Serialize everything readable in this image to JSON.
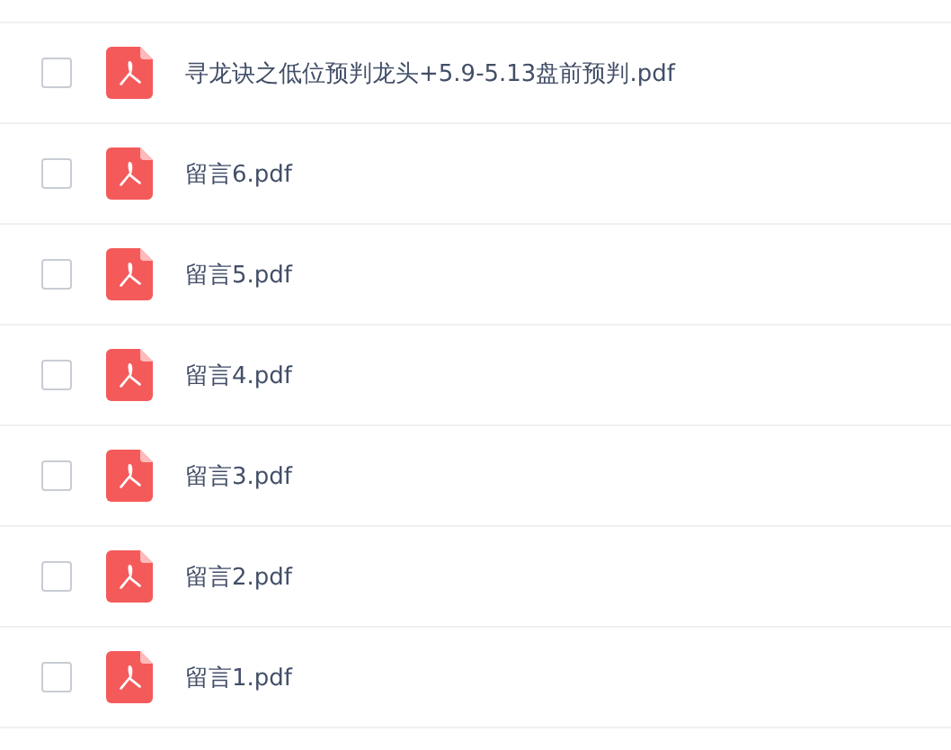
{
  "files": [
    {
      "name": "寻龙诀之低位预判龙头+5.9-5.13盘前预判.pdf",
      "checked": false
    },
    {
      "name": "留言6.pdf",
      "checked": false
    },
    {
      "name": "留言5.pdf",
      "checked": false
    },
    {
      "name": "留言4.pdf",
      "checked": false
    },
    {
      "name": "留言3.pdf",
      "checked": false
    },
    {
      "name": "留言2.pdf",
      "checked": false
    },
    {
      "name": "留言1.pdf",
      "checked": false
    }
  ]
}
